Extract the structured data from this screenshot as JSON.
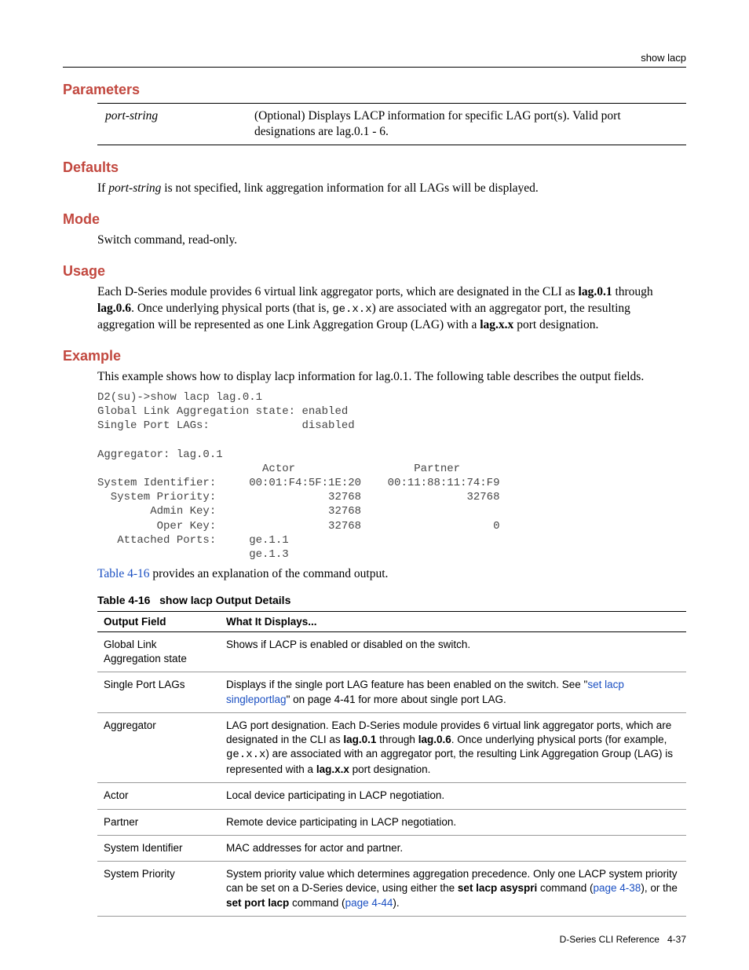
{
  "header": {
    "breadcrumb": "show lacp"
  },
  "sections": {
    "parameters": {
      "title": "Parameters",
      "param_name": "port-string",
      "param_desc": "(Optional) Displays LACP information for specific LAG port(s). Valid port designations are lag.0.1 - 6."
    },
    "defaults": {
      "title": "Defaults",
      "text_pre": "If ",
      "text_em": "port-string",
      "text_post": " is not specified, link aggregation information for all LAGs will be displayed."
    },
    "mode": {
      "title": "Mode",
      "text": "Switch command, read-only."
    },
    "usage": {
      "title": "Usage",
      "line": "Each D-Series module provides 6 virtual link aggregator ports, which are designated in the CLI as ",
      "b1": "lag.0.1",
      "mid1": " through ",
      "b2": "lag.0.6",
      "mid2": ". Once underlying physical ports (that is, ",
      "code": "ge.x.x",
      "mid3": ") are associated with an aggregator port, the resulting aggregation will be represented as one Link Aggregation Group (LAG) with a ",
      "b3": "lag.x.x",
      "end": " port designation."
    },
    "example": {
      "title": "Example",
      "intro_a": "This example shows how to display lacp information for lag.0.1",
      "intro_b": ". The following table describes the output fields.",
      "terminal": "D2(su)->show lacp lag.0.1\nGlobal Link Aggregation state: enabled\nSingle Port LAGs:              disabled\n\nAggregator: lag.0.1\n                         Actor                  Partner\nSystem Identifier:     00:01:F4:5F:1E:20    00:11:88:11:74:F9\n  System Priority:                 32768                32768\n        Admin Key:                 32768\n         Oper Key:                 32768                    0\n   Attached Ports:     ge.1.1\n                       ge.1.3",
      "table_ref_link": "Table 4-16",
      "table_ref_text": " provides an explanation of the command output."
    }
  },
  "table": {
    "caption_num": "Table 4-16",
    "caption_title": "show lacp Output Details",
    "head_field": "Output Field",
    "head_desc": "What It Displays...",
    "rows": [
      {
        "field": "Global Link Aggregation state",
        "desc_plain": "Shows if LACP is enabled or disabled on the switch."
      },
      {
        "field": "Single Port LAGs",
        "desc_pre": "Displays if the single port LAG feature has been enabled on the switch. See \"",
        "desc_link": "set lacp singleportlag",
        "desc_post": "\" on page 4-41 for more about single port LAG."
      },
      {
        "field": "Aggregator",
        "agg_a": "LAG port designation. Each D-Series module provides 6 virtual link aggregator ports, which are designated in the CLI as ",
        "agg_b1": "lag.0.1",
        "agg_mid1": " through ",
        "agg_b2": "lag.0.6",
        "agg_c": ". Once underlying physical ports (for example, ",
        "agg_code": "ge.x.x",
        "agg_d": ") are associated with an aggregator port, the resulting Link Aggregation Group (LAG) is represented with a ",
        "agg_b3": "lag.x.x",
        "agg_e": " port designation."
      },
      {
        "field": "Actor",
        "desc_plain": "Local device participating in LACP negotiation."
      },
      {
        "field": "Partner",
        "desc_plain": "Remote device participating in LACP negotiation."
      },
      {
        "field": "System Identifier",
        "desc_plain": "MAC addresses for actor and partner."
      },
      {
        "field": "System Priority",
        "sp_a": "System priority value which determines aggregation precedence. Only one LACP system priority can be set on a D-Series device, using either the ",
        "sp_b1": "set lacp asyspri",
        "sp_mid1": " command (",
        "sp_link1": "page 4-38",
        "sp_mid2": "), or the ",
        "sp_b2": "set port lacp",
        "sp_mid3": " command (",
        "sp_link2": "page 4-44",
        "sp_end": ")."
      }
    ]
  },
  "footer": {
    "doc": "D-Series CLI Reference",
    "page": "4-37"
  },
  "chart_data": {
    "type": "table",
    "title": "show lacp lag.0.1 output",
    "global_link_aggregation_state": "enabled",
    "single_port_lags": "disabled",
    "aggregator": "lag.0.1",
    "columns": [
      "Actor",
      "Partner"
    ],
    "rows": {
      "System Identifier": [
        "00:01:F4:5F:1E:20",
        "00:11:88:11:74:F9"
      ],
      "System Priority": [
        32768,
        32768
      ],
      "Admin Key": [
        32768,
        null
      ],
      "Oper Key": [
        32768,
        0
      ]
    },
    "attached_ports": [
      "ge.1.1",
      "ge.1.3"
    ]
  }
}
